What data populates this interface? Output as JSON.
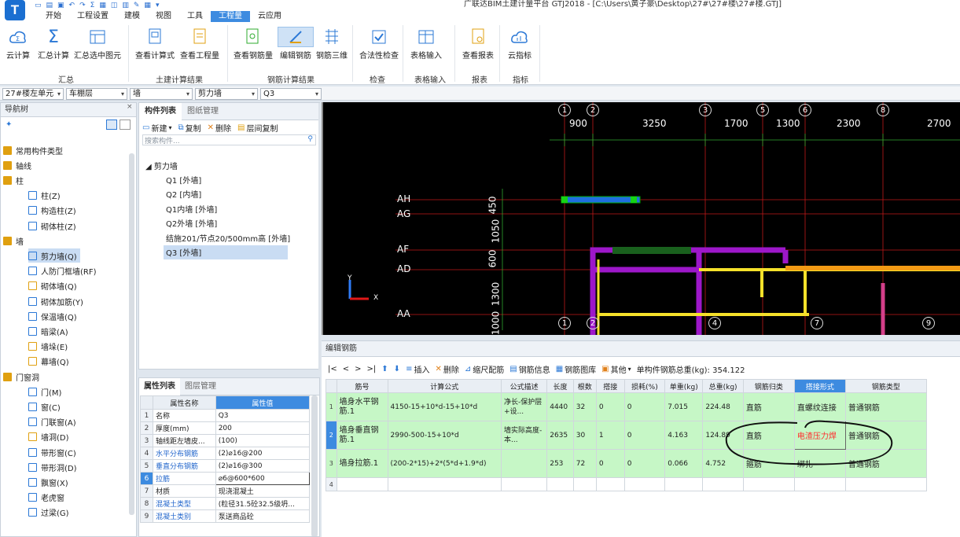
{
  "window": {
    "title": "广联达BIM土建计量平台 GTJ2018 - [C:\\Users\\黄子豪\\Desktop\\27#\\27#楼\\27#楼.GTJ]",
    "app_icon_letter": "T"
  },
  "menu": {
    "tabs": [
      "开始",
      "工程设置",
      "建模",
      "视图",
      "工具",
      "工程量",
      "云应用"
    ],
    "active": "工程量"
  },
  "ribbon": {
    "buttons": [
      "云计算",
      "汇总计算",
      "汇总选中图元",
      "查看计算式",
      "查看工程量",
      "查看钢筋量",
      "编辑钢筋",
      "钢筋三维",
      "合法性检查",
      "表格输入",
      "查看报表",
      "云指标"
    ],
    "groups": [
      "汇总",
      "土建计算结果",
      "钢筋计算结果",
      "检查",
      "表格输入",
      "报表",
      "指标"
    ],
    "active_button": "编辑钢筋"
  },
  "selectors": [
    "27#楼左单元",
    "车棚层",
    "墙",
    "剪力墙",
    "Q3"
  ],
  "nav_tree": {
    "title": "导航树",
    "items": [
      {
        "label": "常用构件类型",
        "level": 0
      },
      {
        "label": "轴线",
        "level": 0
      },
      {
        "label": "柱",
        "level": 0
      },
      {
        "label": "柱(Z)",
        "level": 1
      },
      {
        "label": "构造柱(Z)",
        "level": 1
      },
      {
        "label": "砌体柱(Z)",
        "level": 1
      },
      {
        "label": "墙",
        "level": 0
      },
      {
        "label": "剪力墙(Q)",
        "level": 1
      },
      {
        "label": "人防门框墙(RF)",
        "level": 1
      },
      {
        "label": "砌体墙(Q)",
        "level": 1
      },
      {
        "label": "砌体加筋(Y)",
        "level": 1
      },
      {
        "label": "保温墙(Q)",
        "level": 1
      },
      {
        "label": "暗梁(A)",
        "level": 1
      },
      {
        "label": "墙垛(E)",
        "level": 1
      },
      {
        "label": "幕墙(Q)",
        "level": 1
      },
      {
        "label": "门窗洞",
        "level": 0
      },
      {
        "label": "门(M)",
        "level": 1
      },
      {
        "label": "窗(C)",
        "level": 1
      },
      {
        "label": "门联窗(A)",
        "level": 1
      },
      {
        "label": "墙洞(D)",
        "level": 1
      },
      {
        "label": "带形窗(C)",
        "level": 1
      },
      {
        "label": "带形洞(D)",
        "level": 1
      },
      {
        "label": "飘窗(X)",
        "level": 1
      },
      {
        "label": "老虎窗",
        "level": 1
      },
      {
        "label": "过梁(G)",
        "level": 1
      }
    ],
    "selected": "剪力墙(Q)"
  },
  "component_list": {
    "tabs": [
      "构件列表",
      "图纸管理"
    ],
    "toolbar": [
      "新建",
      "复制",
      "删除",
      "层间复制"
    ],
    "search_placeholder": "搜索构件...",
    "group": "剪力墙",
    "items": [
      "Q1 [外墙]",
      "Q2 [内墙]",
      "Q1内墙 [外墙]",
      "Q2外墙 [外墙]",
      "结施201/节点20/500mm高 [外墙]",
      "Q3 [外墙]"
    ],
    "selected": "Q3 [外墙]"
  },
  "property_list": {
    "tabs": [
      "属性列表",
      "图层管理"
    ],
    "headers": [
      "属性名称",
      "属性值"
    ],
    "rows": [
      {
        "n": "1",
        "name": "名称",
        "value": "Q3"
      },
      {
        "n": "2",
        "name": "厚度(mm)",
        "value": "200"
      },
      {
        "n": "3",
        "name": "轴线距左墙皮...",
        "value": "(100)"
      },
      {
        "n": "4",
        "name": "水平分布钢筋",
        "value": "(2)⌀16@200"
      },
      {
        "n": "5",
        "name": "垂直分布钢筋",
        "value": "(2)⌀16@300"
      },
      {
        "n": "6",
        "name": "拉筋",
        "value": "⌀6@600*600"
      },
      {
        "n": "7",
        "name": "材质",
        "value": "现浇混凝土"
      },
      {
        "n": "8",
        "name": "混凝土类型",
        "value": "(粒径31.5砼32.5级坍..."
      },
      {
        "n": "9",
        "name": "混凝土类别",
        "value": "泵送商品砼"
      }
    ]
  },
  "cad": {
    "axis_top": [
      "1",
      "2",
      "3",
      "5",
      "6",
      "8"
    ],
    "dims_top": [
      "900",
      "3250",
      "1700",
      "1300",
      "2300",
      "2700"
    ],
    "axis_left": [
      "AH",
      "AG",
      "AF",
      "AD",
      "AA"
    ],
    "dims_left": [
      "450",
      "1050",
      "600",
      "1300",
      "1000"
    ],
    "axis_bottom": [
      "1",
      "2",
      "4",
      "7",
      "9"
    ],
    "coord_y": "Y",
    "coord_x": "X"
  },
  "rebar_editor": {
    "title": "编辑钢筋",
    "toolbar": [
      "插入",
      "删除",
      "缩尺配筋",
      "钢筋信息",
      "钢筋图库",
      "其他"
    ],
    "nav_symbols": [
      "|<",
      "<",
      ">",
      ">|"
    ],
    "total_label": "单构件钢筋总重(kg): 354.122",
    "columns": [
      "筋号",
      "计算公式",
      "公式描述",
      "长度",
      "根数",
      "搭接",
      "损耗(%)",
      "单重(kg)",
      "总重(kg)",
      "钢筋归类",
      "搭接形式",
      "钢筋类型"
    ],
    "rows": [
      {
        "n": "1",
        "name": "墙身水平钢筋.1",
        "formula": "4150-15+10*d-15+10*d",
        "desc": "净长-保护层+设...",
        "length": "4440",
        "count": "32",
        "lap": "0",
        "loss": "0",
        "unit": "7.015",
        "total": "224.48",
        "class": "直筋",
        "lapform": "直螺纹连接",
        "type": "普通钢筋"
      },
      {
        "n": "2",
        "name": "墙身垂直钢筋.1",
        "formula": "2990-500-15+10*d",
        "desc": "墙实际高度-本...",
        "length": "2635",
        "count": "30",
        "lap": "1",
        "loss": "0",
        "unit": "4.163",
        "total": "124.89",
        "class": "直筋",
        "lapform": "电渣压力焊",
        "type": "普通钢筋"
      },
      {
        "n": "3",
        "name": "墙身拉筋.1",
        "formula": "(200-2*15)+2*(5*d+1.9*d)",
        "desc": "",
        "length": "253",
        "count": "72",
        "lap": "0",
        "loss": "0",
        "unit": "0.066",
        "total": "4.752",
        "class": "箍筋",
        "lapform": "绑扎",
        "type": "普通钢筋"
      },
      {
        "n": "4",
        "name": "",
        "formula": "",
        "desc": "",
        "length": "",
        "count": "",
        "lap": "",
        "loss": "",
        "unit": "",
        "total": "",
        "class": "",
        "lapform": "",
        "type": ""
      }
    ],
    "highlight_color": "#ff2d2d"
  },
  "colors": {
    "accent": "#3d8be0",
    "row_green": "#c6f7c6",
    "cad_bg": "#000000",
    "axis_red": "#d01818",
    "wall_purple": "#9d17c9",
    "wall_yellow": "#f5e12a"
  }
}
